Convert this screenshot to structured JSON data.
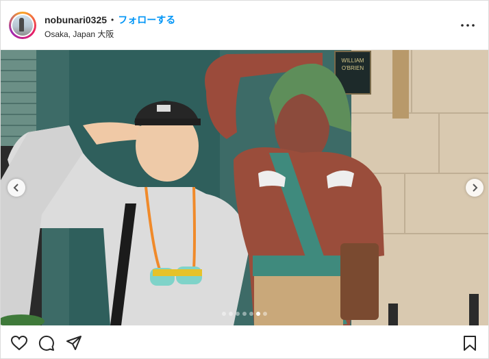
{
  "post": {
    "username": "nobunari0325",
    "separator": "•",
    "follow_label": "フォローする",
    "location": "Osaka, Japan 大阪"
  },
  "carousel": {
    "slide_count": 7,
    "active_index": 5
  },
  "photo": {
    "sign_line1": "WILLIAM",
    "sign_line2": "O'BRIEN"
  },
  "icons": {
    "more": "more-options-icon",
    "like": "heart-icon",
    "comment": "comment-icon",
    "share": "share-icon",
    "save": "bookmark-icon",
    "prev": "chevron-left-icon",
    "next": "chevron-right-icon"
  },
  "colors": {
    "follow": "#0095f6",
    "text": "#262626"
  }
}
